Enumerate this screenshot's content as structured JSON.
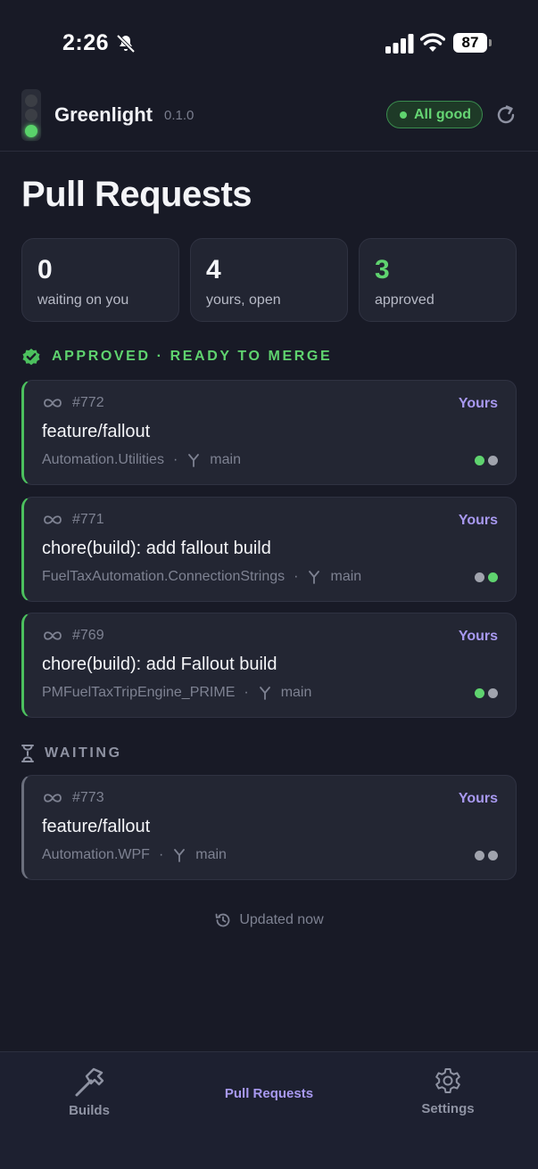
{
  "status_bar": {
    "time": "2:26",
    "battery": "87"
  },
  "header": {
    "app_name": "Greenlight",
    "version": "0.1.0",
    "status": "All good"
  },
  "page": {
    "title": "Pull Requests"
  },
  "stats": [
    {
      "value": "0",
      "label": "waiting on you"
    },
    {
      "value": "4",
      "label": "yours, open"
    },
    {
      "value": "3",
      "label": "approved"
    }
  ],
  "sections": {
    "approved": {
      "label": "APPROVED · READY TO MERGE"
    },
    "waiting": {
      "label": "WAITING"
    }
  },
  "approved_prs": [
    {
      "number": "#772",
      "owner": "Yours",
      "title": "feature/fallout",
      "repo": "Automation.Utilities",
      "sep": "·",
      "branch": "main",
      "checks": [
        "green",
        "gray"
      ]
    },
    {
      "number": "#771",
      "owner": "Yours",
      "title": "chore(build): add fallout build",
      "repo": "FuelTaxAutomation.ConnectionStrings",
      "sep": "·",
      "branch": "main",
      "checks": [
        "gray",
        "green"
      ]
    },
    {
      "number": "#769",
      "owner": "Yours",
      "title": "chore(build): add Fallout build",
      "repo": "PMFuelTaxTripEngine_PRIME",
      "sep": "·",
      "branch": "main",
      "checks": [
        "green",
        "gray"
      ]
    }
  ],
  "waiting_prs": [
    {
      "number": "#773",
      "owner": "Yours",
      "title": "feature/fallout",
      "repo": "Automation.WPF",
      "sep": "·",
      "branch": "main",
      "checks": [
        "gray",
        "gray"
      ]
    }
  ],
  "footer": {
    "updated": "Updated now"
  },
  "tabs": {
    "builds": "Builds",
    "pull_requests": "Pull Requests",
    "settings": "Settings"
  },
  "colors": {
    "accent": "#a899f0",
    "success": "#5fd36f",
    "background": "#181a26"
  }
}
